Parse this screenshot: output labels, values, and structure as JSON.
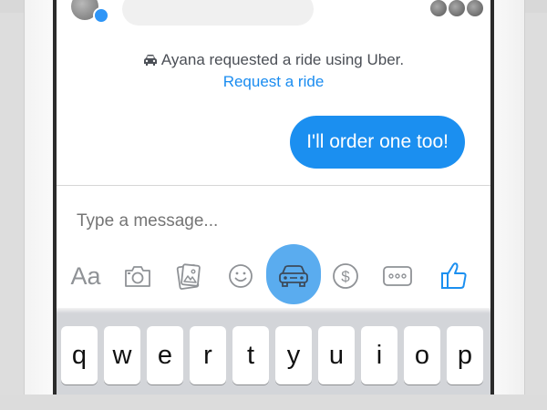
{
  "chat": {
    "notice_text": "Ayana requested a ride using Uber.",
    "request_link": "Request a ride",
    "outgoing_message": "I'll order one too!"
  },
  "composer": {
    "placeholder": "Type a message...",
    "aa_label": "Aa"
  },
  "toolbar": {
    "icons": [
      "text-format-icon",
      "camera-icon",
      "gallery-icon",
      "emoji-icon",
      "car-icon",
      "payment-icon",
      "more-icon",
      "thumbs-up-icon"
    ],
    "active": "car-icon"
  },
  "keyboard": {
    "row1": [
      "q",
      "w",
      "e",
      "r",
      "t",
      "y",
      "u",
      "i",
      "o",
      "p"
    ]
  },
  "colors": {
    "accent": "#1b8ff0",
    "ride_highlight": "#5aacef",
    "link": "#1a8cf0"
  }
}
